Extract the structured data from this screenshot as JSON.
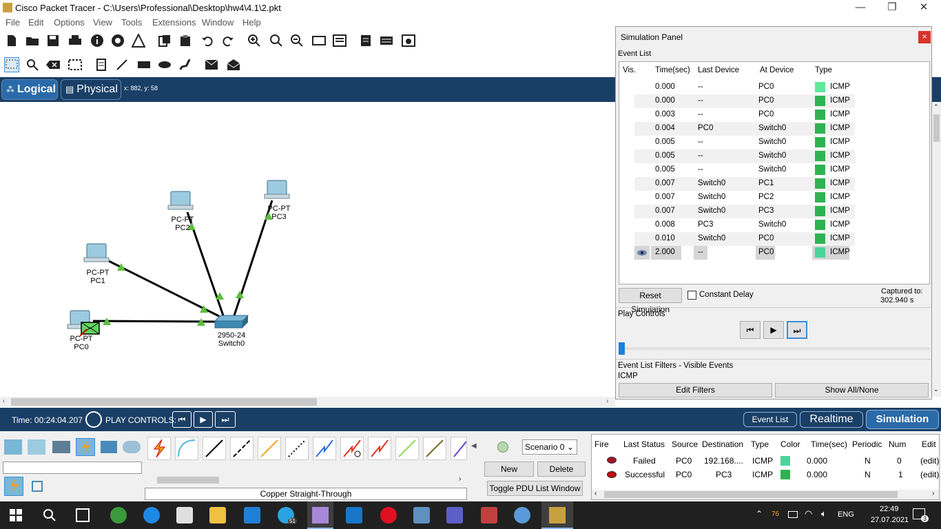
{
  "window": {
    "title": "Cisco Packet Tracer - C:\\Users\\Professional\\Desktop\\hw4\\4.1\\2.pkt"
  },
  "menu": [
    "File",
    "Edit",
    "Options",
    "View",
    "Tools",
    "Extensions",
    "Window",
    "Help"
  ],
  "workspace": {
    "logical_label": "Logical",
    "physical_label": "Physical",
    "coords": "x: 882, y: 58"
  },
  "devices": [
    {
      "model": "PC-PT",
      "name": "PC0"
    },
    {
      "model": "PC-PT",
      "name": "PC1"
    },
    {
      "model": "PC-PT",
      "name": "PC2"
    },
    {
      "model": "PC-PT",
      "name": "PC3"
    },
    {
      "model": "2950-24",
      "name": "Switch0"
    }
  ],
  "sim_panel": {
    "title": "Simulation Panel",
    "event_list_label": "Event List",
    "columns": [
      "Vis.",
      "Time(sec)",
      "Last Device",
      "At Device",
      "Type"
    ],
    "events": [
      {
        "time": "0.000",
        "last": "--",
        "at": "PC0",
        "type": "ICMP"
      },
      {
        "time": "0.000",
        "last": "--",
        "at": "PC0",
        "type": "ICMP"
      },
      {
        "time": "0.003",
        "last": "--",
        "at": "PC0",
        "type": "ICMP"
      },
      {
        "time": "0.004",
        "last": "PC0",
        "at": "Switch0",
        "type": "ICMP"
      },
      {
        "time": "0.005",
        "last": "--",
        "at": "Switch0",
        "type": "ICMP"
      },
      {
        "time": "0.005",
        "last": "--",
        "at": "Switch0",
        "type": "ICMP"
      },
      {
        "time": "0.005",
        "last": "--",
        "at": "Switch0",
        "type": "ICMP"
      },
      {
        "time": "0.007",
        "last": "Switch0",
        "at": "PC1",
        "type": "ICMP"
      },
      {
        "time": "0.007",
        "last": "Switch0",
        "at": "PC2",
        "type": "ICMP"
      },
      {
        "time": "0.007",
        "last": "Switch0",
        "at": "PC3",
        "type": "ICMP"
      },
      {
        "time": "0.008",
        "last": "PC3",
        "at": "Switch0",
        "type": "ICMP"
      },
      {
        "time": "0.010",
        "last": "Switch0",
        "at": "PC0",
        "type": "ICMP"
      },
      {
        "time": "2.000",
        "last": "--",
        "at": "PC0",
        "type": "ICMP"
      }
    ],
    "reset_label": "Reset Simulation",
    "constant_delay_label": "Constant Delay",
    "captured_label": "Captured to:",
    "captured_value": "302.940 s",
    "play_controls_label": "Play Controls",
    "filters_label": "Event List Filters - Visible Events",
    "filters_value": "ICMP",
    "edit_filters_label": "Edit Filters",
    "show_all_label": "Show All/None"
  },
  "bottom_bar": {
    "time": "Time: 00:24:04.207",
    "play_controls": "PLAY CONTROLS:",
    "event_list": "Event List",
    "realtime": "Realtime",
    "simulation": "Simulation"
  },
  "cable_label": "Copper Straight-Through",
  "scenario": {
    "selected": "Scenario 0",
    "new_label": "New",
    "delete_label": "Delete",
    "toggle_label": "Toggle PDU List Window"
  },
  "pdu_table": {
    "columns": [
      "Fire",
      "Last Status",
      "Source",
      "Destination",
      "Type",
      "Color",
      "Time(sec)",
      "Periodic",
      "Num",
      "Edit"
    ],
    "rows": [
      {
        "status": "Failed",
        "source": "PC0",
        "dest": "192.168....",
        "type": "ICMP",
        "time": "0.000",
        "periodic": "N",
        "num": "0",
        "edit": "(edit)"
      },
      {
        "status": "Successful",
        "source": "PC0",
        "dest": "PC3",
        "type": "ICMP",
        "time": "0.000",
        "periodic": "N",
        "num": "1",
        "edit": "(edit)"
      }
    ]
  },
  "taskbar": {
    "time": "22:49",
    "date": "27.07.2021",
    "lang": "ENG",
    "battery": "76",
    "notifications": "3",
    "telegram_badge": "51"
  }
}
